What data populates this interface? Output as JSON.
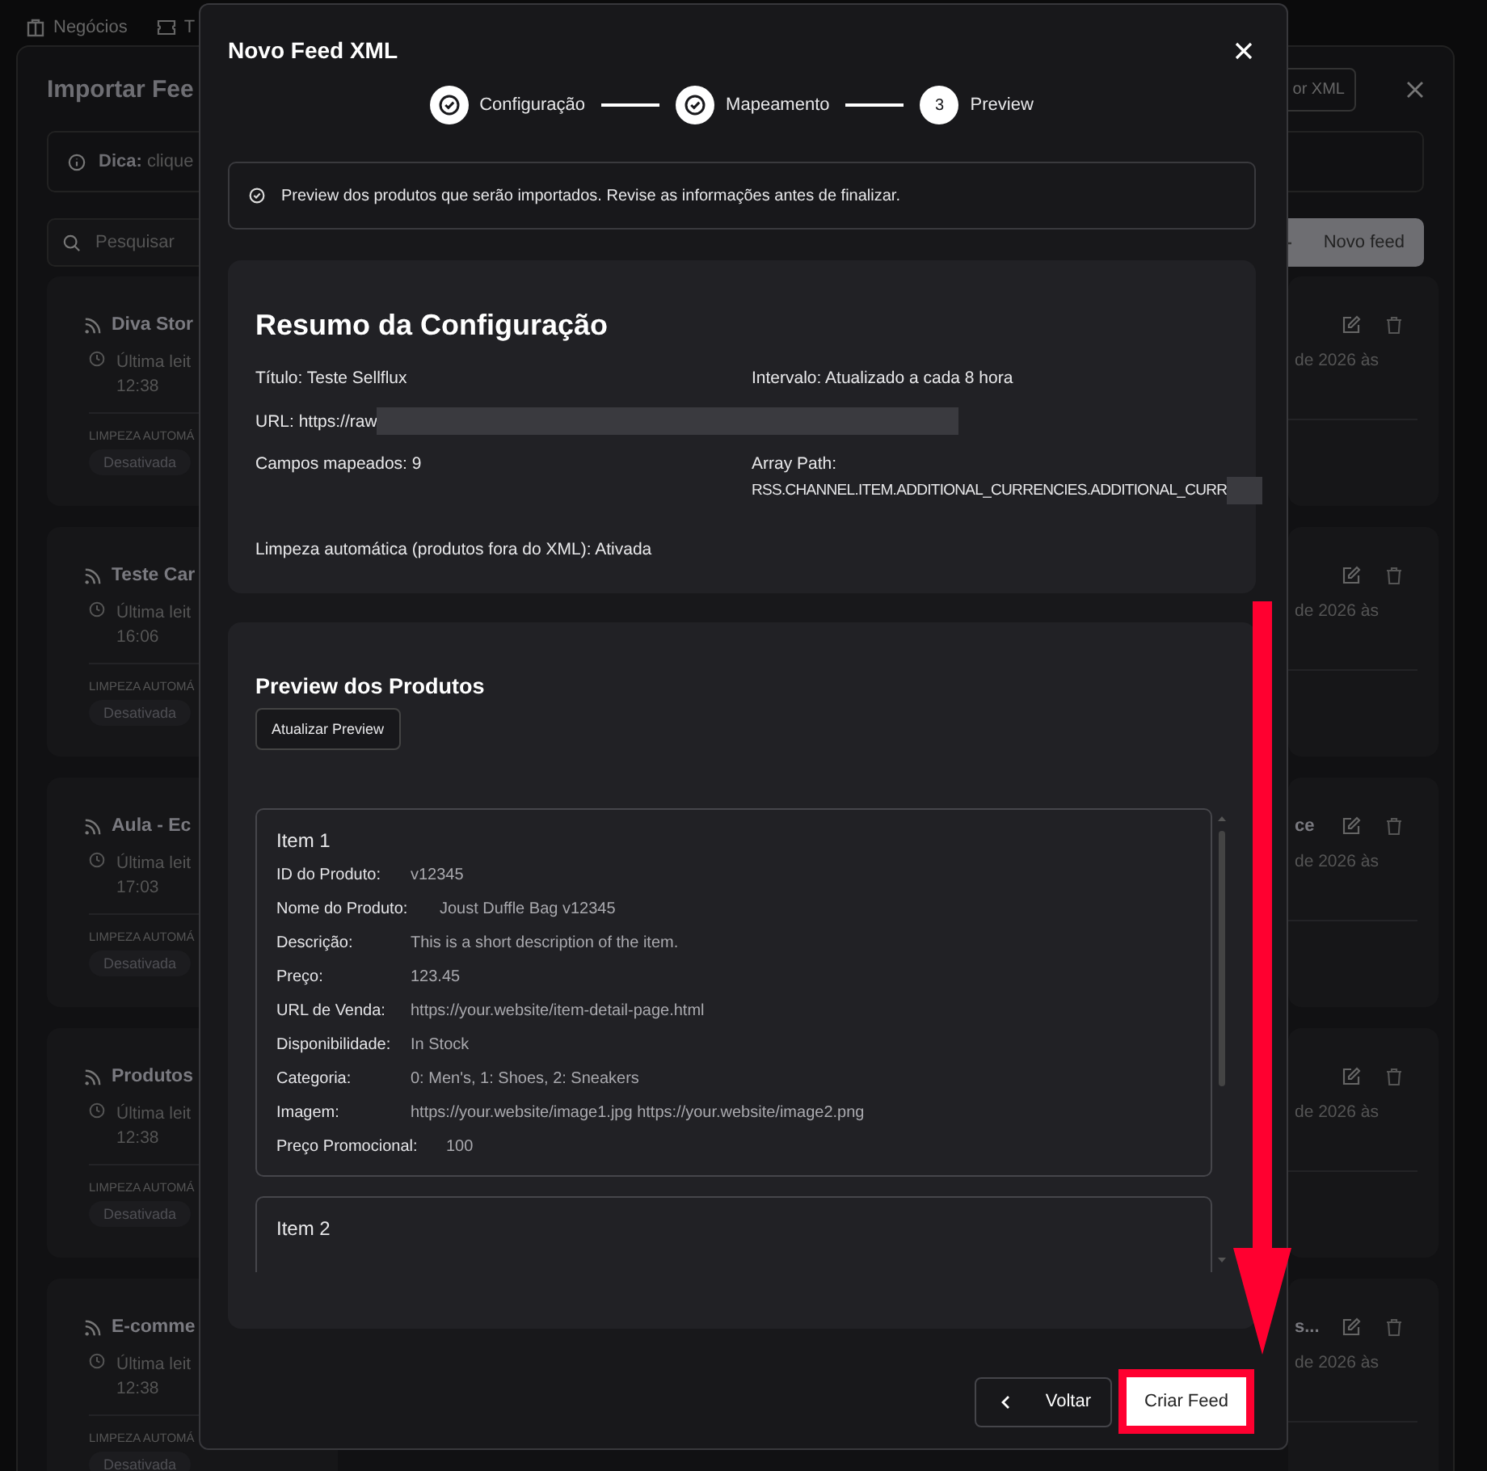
{
  "nav": {
    "items": [
      {
        "label": "Negócios",
        "kind": "building"
      },
      {
        "label": "T",
        "kind": "ticket"
      }
    ]
  },
  "background_panel": {
    "title": "Importar Fee",
    "import_button": "or XML",
    "tip_label": "Dica:",
    "tip_text": "clique",
    "search": {
      "placeholder": "Pesquisar"
    },
    "new_feed_button": "Novo feed",
    "left_cards": [
      {
        "title": "Diva Stor",
        "last_read": "Última leit",
        "time": "12:38",
        "cleanup_label": "LIMPEZA AUTOMÁ",
        "cleanup_value": "Desativada"
      },
      {
        "title": "Teste Car",
        "last_read": "Última leit",
        "time": "16:06",
        "cleanup_label": "LIMPEZA AUTOMÁ",
        "cleanup_value": "Desativada"
      },
      {
        "title": "Aula - Ec",
        "last_read": "Última leit",
        "time": "17:03",
        "cleanup_label": "LIMPEZA AUTOMÁ",
        "cleanup_value": "Desativada"
      },
      {
        "title": "Produtos",
        "last_read": "Última leit",
        "time": "12:38",
        "cleanup_label": "LIMPEZA AUTOMÁ",
        "cleanup_value": "Desativada"
      },
      {
        "title": "E-comme",
        "last_read": "Última leit",
        "time": "12:38",
        "cleanup_label": "LIMPEZA AUTOMÁ",
        "cleanup_value": "Desativada"
      }
    ],
    "right_cards": [
      {
        "date": "de 2026 às"
      },
      {
        "date": "de 2026 às"
      },
      {
        "title": "ce",
        "date": "de 2026 às"
      },
      {
        "date": "de 2026 às"
      },
      {
        "title": "s...",
        "date": "de 2026 às"
      }
    ]
  },
  "modal": {
    "title": "Novo Feed XML",
    "steps": [
      {
        "label": "Configuração",
        "done": true
      },
      {
        "label": "Mapeamento",
        "done": true
      },
      {
        "label": "Preview",
        "done": false,
        "number": "3"
      }
    ],
    "info": "Preview dos produtos que serão importados. Revise as informações antes de finalizar.",
    "summary": {
      "title": "Resumo da Configuração",
      "rows": [
        [
          {
            "text": "Título: Teste Sellflux",
            "redacted": false
          },
          {
            "text": "Intervalo: Atualizado a cada 8 hora",
            "redacted": false
          }
        ],
        [
          {
            "text": "URL: https://raw",
            "redacted": true
          }
        ],
        [
          {
            "text": "Campos mapeados: 9",
            "redacted": false
          },
          {
            "label": "Array Path:",
            "text": "RSS.CHANNEL.ITEM.ADDITIONAL_CURRENCIES.ADDITIONAL_CURR",
            "redacted": true
          }
        ],
        [
          {
            "text": "Limpeza automática (produtos fora do XML): Ativada",
            "redacted": false
          }
        ]
      ]
    },
    "preview": {
      "title": "Preview dos Produtos",
      "refresh_button": "Atualizar Preview",
      "items": [
        {
          "title": "Item 1",
          "fields": [
            {
              "label": "ID do Produto:",
              "value": "v12345"
            },
            {
              "label": "Nome do Produto:",
              "value": "Joust Duffle Bag v12345"
            },
            {
              "label": "Descrição:",
              "value": "This is a short description of the item."
            },
            {
              "label": "Preço:",
              "value": "123.45"
            },
            {
              "label": "URL de Venda:",
              "value": "https://your.website/item-detail-page.html"
            },
            {
              "label": "Disponibilidade:",
              "value": "In Stock"
            },
            {
              "label": "Categoria:",
              "value": "0: Men's, 1: Shoes, 2: Sneakers"
            },
            {
              "label": "Imagem:",
              "value": "https://your.website/image1.jpg https://your.website/image2.png"
            },
            {
              "label": "Preço Promocional:",
              "value": "100"
            }
          ]
        },
        {
          "title": "Item 2"
        }
      ]
    },
    "back_button": "Voltar",
    "create_button": "Criar Feed"
  }
}
